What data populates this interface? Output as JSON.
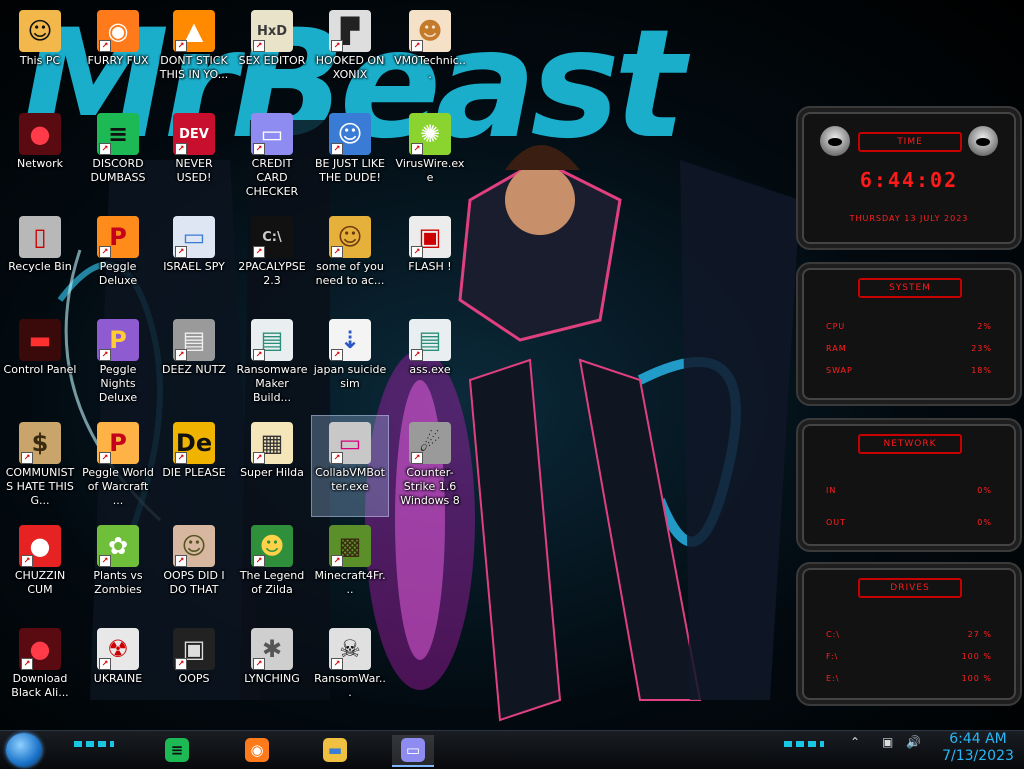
{
  "desktop": {
    "banner_text": "MrBeast",
    "icons": [
      {
        "label": "This PC",
        "glyph": "☺",
        "bg": "#f2b84b",
        "fg": "#111"
      },
      {
        "label": "FURRY FUX",
        "glyph": "◉",
        "bg": "#ff7a1a",
        "fg": "#fff"
      },
      {
        "label": "DONT STICK THIS IN YO...",
        "glyph": "▲",
        "bg": "#ff8a00",
        "fg": "#fff"
      },
      {
        "label": "SEX EDITOR",
        "glyph": "HxD",
        "bg": "#e9e3c9",
        "fg": "#3a3a3a"
      },
      {
        "label": "HOOKED ON XONIX",
        "glyph": "▛",
        "bg": "#dedede",
        "fg": "#222"
      },
      {
        "label": "VM0Technic...",
        "glyph": "☻",
        "bg": "#f5e0c8",
        "fg": "#c47a2b"
      },
      {
        "label": "Network",
        "glyph": "●",
        "bg": "#5a0b12",
        "fg": "#ff3b4a"
      },
      {
        "label": "DISCORD DUMBASS",
        "glyph": "≡",
        "bg": "#1db954",
        "fg": "#111"
      },
      {
        "label": "NEVER USED!",
        "glyph": "DEV",
        "bg": "#c8102e",
        "fg": "#fff"
      },
      {
        "label": "CREDIT CARD CHECKER",
        "glyph": "▭",
        "bg": "#8e8cf0",
        "fg": "#fff"
      },
      {
        "label": "BE JUST LIKE THE DUDE!",
        "glyph": "☺",
        "bg": "#3a7bd5",
        "fg": "#fff"
      },
      {
        "label": "VirusWire.exe",
        "glyph": "✺",
        "bg": "#8bd42f",
        "fg": "#fff"
      },
      {
        "label": "Recycle Bin",
        "glyph": "▯",
        "bg": "#b8b8b8",
        "fg": "#c00"
      },
      {
        "label": "Peggle Deluxe",
        "glyph": "P",
        "bg": "#ff8c1a",
        "fg": "#c4001b"
      },
      {
        "label": "ISRAEL SPY",
        "glyph": "▭",
        "bg": "#dde6f2",
        "fg": "#3a7bd5"
      },
      {
        "label": "2PACALYPSE 2.3",
        "glyph": "C:\\",
        "bg": "#111",
        "fg": "#ccc"
      },
      {
        "label": "some of you need to ac...",
        "glyph": "☺",
        "bg": "#e6b13a",
        "fg": "#6b3a10"
      },
      {
        "label": "FLASH !",
        "glyph": "▣",
        "bg": "#ececec",
        "fg": "#c00"
      },
      {
        "label": "Control Panel",
        "glyph": "▬",
        "bg": "#3a0a0a",
        "fg": "#ff3030"
      },
      {
        "label": "Peggle Nights Deluxe",
        "glyph": "P",
        "bg": "#8e5bd1",
        "fg": "#ffcc33"
      },
      {
        "label": "DEEZ NUTZ",
        "glyph": "▤",
        "bg": "#9a9a9a",
        "fg": "#eee"
      },
      {
        "label": "Ransomware Maker Build...",
        "glyph": "▤",
        "bg": "#e9eef0",
        "fg": "#2a8f7a"
      },
      {
        "label": "japan suicide sim",
        "glyph": "⇣",
        "bg": "#f4f4f4",
        "fg": "#2b56c8"
      },
      {
        "label": "ass.exe",
        "glyph": "▤",
        "bg": "#e9eef0",
        "fg": "#2a8f7a"
      },
      {
        "label": "COMMUNISTS HATE THIS G...",
        "glyph": "$",
        "bg": "#c9a46b",
        "fg": "#3a2a10"
      },
      {
        "label": "Peggle World of Warcraft ...",
        "glyph": "P",
        "bg": "#ffb347",
        "fg": "#c4001b"
      },
      {
        "label": "DIE PLEASE",
        "glyph": "De",
        "bg": "#f0b400",
        "fg": "#111"
      },
      {
        "label": "Super Hilda",
        "glyph": "▦",
        "bg": "#f4e6b8",
        "fg": "#333"
      },
      {
        "label": "CollabVMBotter.exe",
        "glyph": "▭",
        "bg": "#c8c8c8",
        "fg": "#d6007a"
      },
      {
        "label": "Counter-Strike 1.6 Windows 8",
        "glyph": "☄",
        "bg": "#9a9a9a",
        "fg": "#222"
      },
      {
        "label": "CHUZZIN CUM",
        "glyph": "●",
        "bg": "#e62222",
        "fg": "#fff"
      },
      {
        "label": "Plants vs Zombies",
        "glyph": "✿",
        "bg": "#6fbf3a",
        "fg": "#fff"
      },
      {
        "label": "OOPS DID I DO THAT",
        "glyph": "☺",
        "bg": "#d7b7a0",
        "fg": "#552"
      },
      {
        "label": "The Legend of Zilda",
        "glyph": "☻",
        "bg": "#2f8f3a",
        "fg": "#ffd24a"
      },
      {
        "label": "Minecraft4Fr...",
        "glyph": "▩",
        "bg": "#5b8f2a",
        "fg": "#3a2a10"
      },
      {
        "label": "Download Black Ali...",
        "glyph": "●",
        "bg": "#5a0b12",
        "fg": "#ff3b4a"
      },
      {
        "label": "UKRAINE",
        "glyph": "☢",
        "bg": "#e8e8e8",
        "fg": "#c00"
      },
      {
        "label": "OOPS",
        "glyph": "▣",
        "bg": "#222",
        "fg": "#ddd"
      },
      {
        "label": "LYNCHING",
        "glyph": "✱",
        "bg": "#cfcfcf",
        "fg": "#555"
      },
      {
        "label": "RansomWar...",
        "glyph": "☠",
        "bg": "#e0e0e0",
        "fg": "#111"
      }
    ]
  },
  "widgets": {
    "time": {
      "title": "TIME",
      "clock": "6:44:02",
      "date": "THURSDAY 13 JULY 2023"
    },
    "system": {
      "title": "SYSTEM",
      "rows": [
        {
          "label": "CPU",
          "value": "2%"
        },
        {
          "label": "RAM",
          "value": "23%"
        },
        {
          "label": "SWAP",
          "value": "18%"
        }
      ]
    },
    "network": {
      "title": "NETWORK",
      "rows": [
        {
          "label": "IN",
          "value": "0%"
        },
        {
          "label": "OUT",
          "value": "0%"
        }
      ]
    },
    "drives": {
      "title": "DRIVES",
      "rows": [
        {
          "label": "C:\\",
          "value": "27 %"
        },
        {
          "label": "F:\\",
          "value": "100 %"
        },
        {
          "label": "E:\\",
          "value": "100 %"
        }
      ]
    }
  },
  "taskbar": {
    "pinned": [
      {
        "name": "spotify",
        "glyph": "≡",
        "bg": "#1db954",
        "fg": "#111"
      },
      {
        "name": "firefox",
        "glyph": "◉",
        "bg": "#ff7a1a",
        "fg": "#fff"
      },
      {
        "name": "file-explorer",
        "glyph": "▬",
        "bg": "#f0c040",
        "fg": "#3a7bd5"
      },
      {
        "name": "credit-card-app",
        "glyph": "▭",
        "bg": "#8e8cf0",
        "fg": "#fff"
      }
    ],
    "clock_time": "6:44 AM",
    "clock_date": "7/13/2023",
    "tray_icons": [
      "⚑",
      "▣",
      "🔊"
    ]
  }
}
